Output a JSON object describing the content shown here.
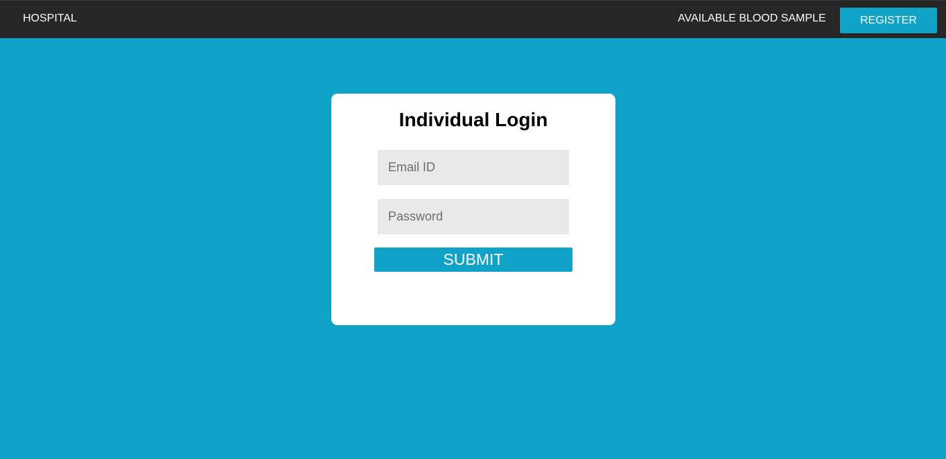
{
  "navbar": {
    "brand": "HOSPITAL",
    "link_label": "AVAILABLE BLOOD SAMPLE",
    "register_label": "REGISTER"
  },
  "login": {
    "title": "Individual Login",
    "email_placeholder": "Email ID",
    "password_placeholder": "Password",
    "submit_label": "SUBMIT"
  },
  "colors": {
    "navbar_bg": "#262626",
    "accent": "#10a3c8",
    "page_bg": "#10a3c8",
    "card_bg": "#ffffff",
    "input_bg": "#e9e9e9"
  }
}
